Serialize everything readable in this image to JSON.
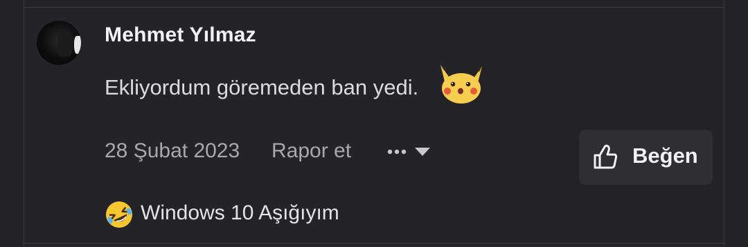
{
  "comment": {
    "author": "Mehmet Yılmaz",
    "message": "Ekliyordum göremeden ban yedi.",
    "sticker": "surprised-pikachu",
    "date": "28 Şubat 2023",
    "report_label": "Rapor et",
    "more_icon": "ellipsis-dropdown",
    "like_label": "Beğen",
    "like_icon": "thumbs-up",
    "reaction": {
      "emoji": "rolling-on-floor-laughing",
      "text": "Windows 10 Aşığıyım"
    }
  },
  "colors": {
    "background": "#242428",
    "text_primary": "#f2f2f2",
    "text_secondary": "#a8a8ad",
    "button_bg": "#2f2f33"
  }
}
